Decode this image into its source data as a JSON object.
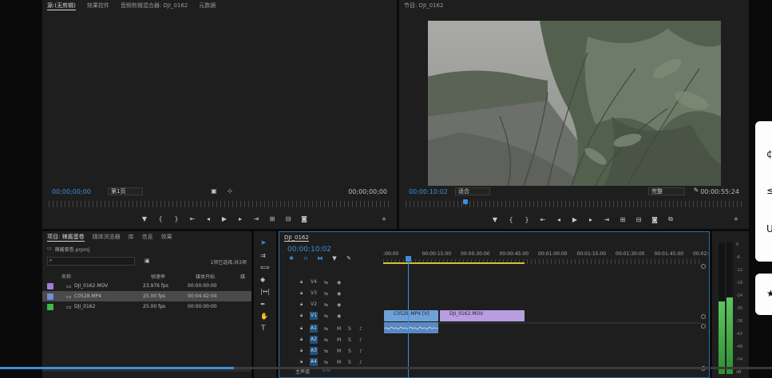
{
  "source_monitor": {
    "tabs": [
      "源:(无剪辑)",
      "效果控件",
      "音频剪辑混合器: DJI_0162",
      "元数据"
    ],
    "active_tab": 0,
    "timecode_left": "00;00;00;00",
    "timecode_right": "00;00;00;00",
    "page_select": "第1页"
  },
  "program_monitor": {
    "tab": "节目: DJI_0162",
    "timecode_left": "00:00:10:02",
    "timecode_right": "00:00:55:24",
    "fit_select": "适合",
    "quality_select": "完整"
  },
  "project": {
    "tabs": [
      "项目: 辣酱蛋卷",
      "媒体浏览器",
      "库",
      "信息",
      "效果"
    ],
    "project_file": "辣酱蛋卷.prproj",
    "selection_info": "1项已选择,共3项",
    "columns": [
      "名称",
      "帧速率",
      "媒体开始",
      "媒"
    ],
    "items": [
      {
        "name": "DJI_0162.MOV",
        "fps": "23.976 fps",
        "start": "00:00:00:00",
        "color": "#9b7fd4",
        "selected": false
      },
      {
        "name": "C0528.MP4",
        "fps": "25.00 fps",
        "start": "00:04:42:04",
        "color": "#6f8fd1",
        "selected": true
      },
      {
        "name": "DJI_0162",
        "fps": "25.00 fps",
        "start": "00:00:00:00",
        "color": "#3fb950",
        "selected": false
      }
    ]
  },
  "timeline": {
    "tab": "DJI_0162",
    "timecode": "00:00:10:02",
    "ruler_labels": [
      ":00:00",
      "00:00:15:00",
      "00:00:30:00",
      "00:00:45:00",
      "00:01:00:00",
      "00:01:15:00",
      "00:01:30:00",
      "00:01:45:00",
      "00:02:00:00"
    ],
    "video_tracks": [
      "V4",
      "V3",
      "V2",
      "V1"
    ],
    "audio_tracks": [
      "A1",
      "A2",
      "A3",
      "A4"
    ],
    "master_label": "主声道",
    "master_value": "0.0",
    "clips": [
      {
        "label": "C0528.MP4 [V]",
        "color": "#6fa1d8"
      },
      {
        "label": "DJI_0162.MOV",
        "color": "#b89ee0"
      }
    ]
  },
  "meter": {
    "labels": [
      "0",
      "-6",
      "-12",
      "-18",
      "-24",
      "-30",
      "-36",
      "-42",
      "-48",
      "-54",
      "dB"
    ],
    "level_left": 0.55,
    "level_right": 0.58
  },
  "colors": {
    "accent": "#3b8fde",
    "playhead": "#3b8fde"
  }
}
